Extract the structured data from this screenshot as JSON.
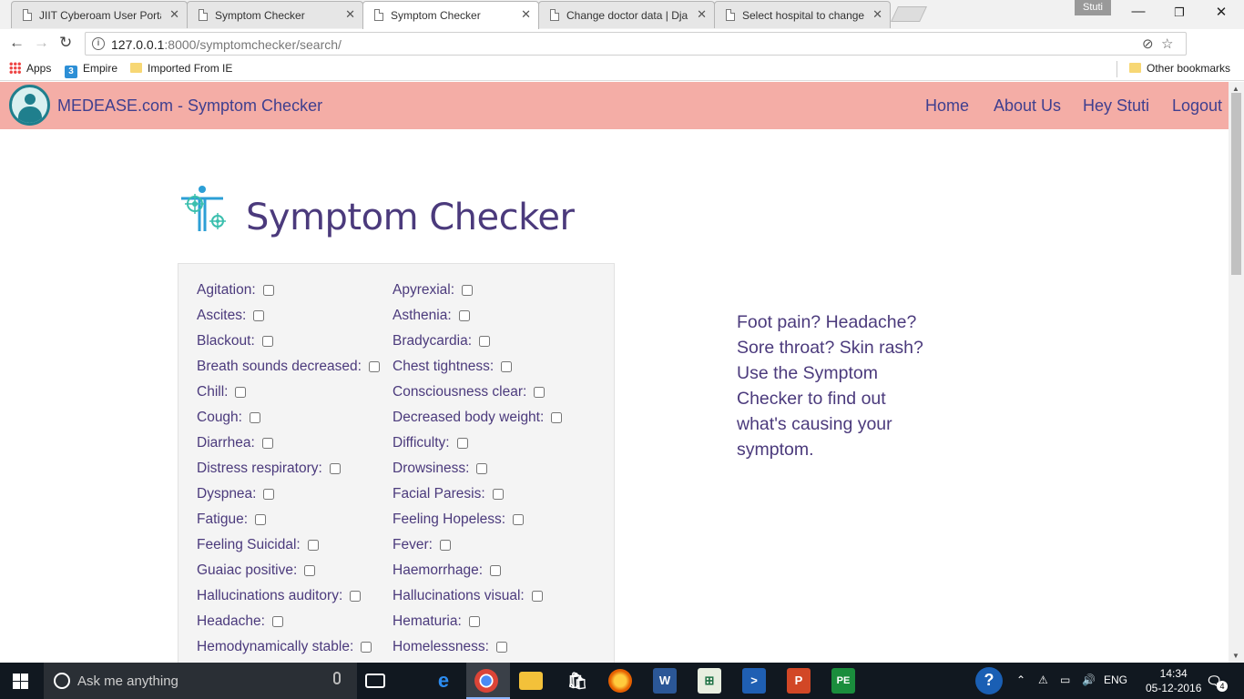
{
  "browser": {
    "tabs": [
      {
        "title": "JIIT Cyberoam User Porta"
      },
      {
        "title": "Symptom Checker"
      },
      {
        "title": "Symptom Checker"
      },
      {
        "title": "Change doctor data | Dja"
      },
      {
        "title": "Select hospital to change"
      }
    ],
    "profile_name": "Stuti",
    "url_host": "127.0.0.1",
    "url_path": ":8000/symptomchecker/search/",
    "bookmarks": {
      "apps": "Apps",
      "empire": "Empire",
      "imported": "Imported From IE",
      "other": "Other bookmarks"
    }
  },
  "navbar": {
    "brand": "MEDEASE.com - Symptom Checker",
    "links": [
      "Home",
      "About Us",
      "Hey Stuti",
      "Logout"
    ]
  },
  "page": {
    "title": "Symptom Checker",
    "tagline": "Foot pain? Headache? Sore throat? Skin rash? Use the Symptom Checker to find out what's causing your symptom."
  },
  "symptoms": {
    "left": [
      "Agitation:",
      "Ascites:",
      "Blackout:",
      "Breath sounds decreased:",
      "Chill:",
      "Cough:",
      "Diarrhea:",
      "Distress respiratory:",
      "Dyspnea:",
      "Fatigue:",
      "Feeling Suicidal:",
      "Guaiac positive:",
      "Hallucinations auditory:",
      "Headache:",
      "Hemodynamically stable:"
    ],
    "right": [
      "Apyrexial:",
      "Asthenia:",
      "Bradycardia:",
      "Chest tightness:",
      "Consciousness clear:",
      "Decreased body weight:",
      "Difficulty:",
      "Drowsiness:",
      "Facial Paresis:",
      "Feeling Hopeless:",
      "Fever:",
      "Haemorrhage:",
      "Hallucinations visual:",
      "Hematuria:",
      "Homelessness:"
    ]
  },
  "taskbar": {
    "search_placeholder": "Ask me anything",
    "lang": "ENG",
    "time": "14:34",
    "date": "05-12-2016",
    "notifications": "4"
  }
}
